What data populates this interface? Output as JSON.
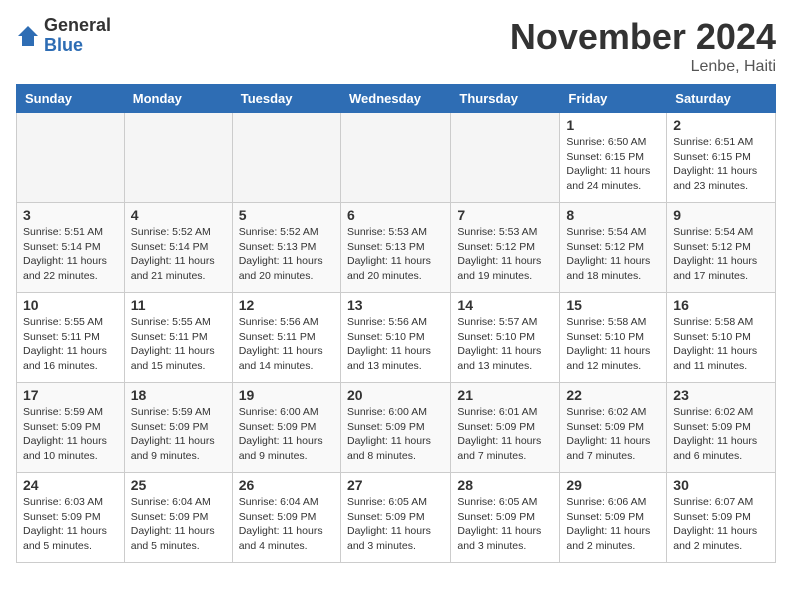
{
  "logo": {
    "general": "General",
    "blue": "Blue"
  },
  "title": "November 2024",
  "location": "Lenbe, Haiti",
  "days_of_week": [
    "Sunday",
    "Monday",
    "Tuesday",
    "Wednesday",
    "Thursday",
    "Friday",
    "Saturday"
  ],
  "weeks": [
    [
      {
        "day": "",
        "info": ""
      },
      {
        "day": "",
        "info": ""
      },
      {
        "day": "",
        "info": ""
      },
      {
        "day": "",
        "info": ""
      },
      {
        "day": "",
        "info": ""
      },
      {
        "day": "1",
        "info": "Sunrise: 6:50 AM\nSunset: 6:15 PM\nDaylight: 11 hours and 24 minutes."
      },
      {
        "day": "2",
        "info": "Sunrise: 6:51 AM\nSunset: 6:15 PM\nDaylight: 11 hours and 23 minutes."
      }
    ],
    [
      {
        "day": "3",
        "info": "Sunrise: 5:51 AM\nSunset: 5:14 PM\nDaylight: 11 hours and 22 minutes."
      },
      {
        "day": "4",
        "info": "Sunrise: 5:52 AM\nSunset: 5:14 PM\nDaylight: 11 hours and 21 minutes."
      },
      {
        "day": "5",
        "info": "Sunrise: 5:52 AM\nSunset: 5:13 PM\nDaylight: 11 hours and 20 minutes."
      },
      {
        "day": "6",
        "info": "Sunrise: 5:53 AM\nSunset: 5:13 PM\nDaylight: 11 hours and 20 minutes."
      },
      {
        "day": "7",
        "info": "Sunrise: 5:53 AM\nSunset: 5:12 PM\nDaylight: 11 hours and 19 minutes."
      },
      {
        "day": "8",
        "info": "Sunrise: 5:54 AM\nSunset: 5:12 PM\nDaylight: 11 hours and 18 minutes."
      },
      {
        "day": "9",
        "info": "Sunrise: 5:54 AM\nSunset: 5:12 PM\nDaylight: 11 hours and 17 minutes."
      }
    ],
    [
      {
        "day": "10",
        "info": "Sunrise: 5:55 AM\nSunset: 5:11 PM\nDaylight: 11 hours and 16 minutes."
      },
      {
        "day": "11",
        "info": "Sunrise: 5:55 AM\nSunset: 5:11 PM\nDaylight: 11 hours and 15 minutes."
      },
      {
        "day": "12",
        "info": "Sunrise: 5:56 AM\nSunset: 5:11 PM\nDaylight: 11 hours and 14 minutes."
      },
      {
        "day": "13",
        "info": "Sunrise: 5:56 AM\nSunset: 5:10 PM\nDaylight: 11 hours and 13 minutes."
      },
      {
        "day": "14",
        "info": "Sunrise: 5:57 AM\nSunset: 5:10 PM\nDaylight: 11 hours and 13 minutes."
      },
      {
        "day": "15",
        "info": "Sunrise: 5:58 AM\nSunset: 5:10 PM\nDaylight: 11 hours and 12 minutes."
      },
      {
        "day": "16",
        "info": "Sunrise: 5:58 AM\nSunset: 5:10 PM\nDaylight: 11 hours and 11 minutes."
      }
    ],
    [
      {
        "day": "17",
        "info": "Sunrise: 5:59 AM\nSunset: 5:09 PM\nDaylight: 11 hours and 10 minutes."
      },
      {
        "day": "18",
        "info": "Sunrise: 5:59 AM\nSunset: 5:09 PM\nDaylight: 11 hours and 9 minutes."
      },
      {
        "day": "19",
        "info": "Sunrise: 6:00 AM\nSunset: 5:09 PM\nDaylight: 11 hours and 9 minutes."
      },
      {
        "day": "20",
        "info": "Sunrise: 6:00 AM\nSunset: 5:09 PM\nDaylight: 11 hours and 8 minutes."
      },
      {
        "day": "21",
        "info": "Sunrise: 6:01 AM\nSunset: 5:09 PM\nDaylight: 11 hours and 7 minutes."
      },
      {
        "day": "22",
        "info": "Sunrise: 6:02 AM\nSunset: 5:09 PM\nDaylight: 11 hours and 7 minutes."
      },
      {
        "day": "23",
        "info": "Sunrise: 6:02 AM\nSunset: 5:09 PM\nDaylight: 11 hours and 6 minutes."
      }
    ],
    [
      {
        "day": "24",
        "info": "Sunrise: 6:03 AM\nSunset: 5:09 PM\nDaylight: 11 hours and 5 minutes."
      },
      {
        "day": "25",
        "info": "Sunrise: 6:04 AM\nSunset: 5:09 PM\nDaylight: 11 hours and 5 minutes."
      },
      {
        "day": "26",
        "info": "Sunrise: 6:04 AM\nSunset: 5:09 PM\nDaylight: 11 hours and 4 minutes."
      },
      {
        "day": "27",
        "info": "Sunrise: 6:05 AM\nSunset: 5:09 PM\nDaylight: 11 hours and 3 minutes."
      },
      {
        "day": "28",
        "info": "Sunrise: 6:05 AM\nSunset: 5:09 PM\nDaylight: 11 hours and 3 minutes."
      },
      {
        "day": "29",
        "info": "Sunrise: 6:06 AM\nSunset: 5:09 PM\nDaylight: 11 hours and 2 minutes."
      },
      {
        "day": "30",
        "info": "Sunrise: 6:07 AM\nSunset: 5:09 PM\nDaylight: 11 hours and 2 minutes."
      }
    ]
  ]
}
